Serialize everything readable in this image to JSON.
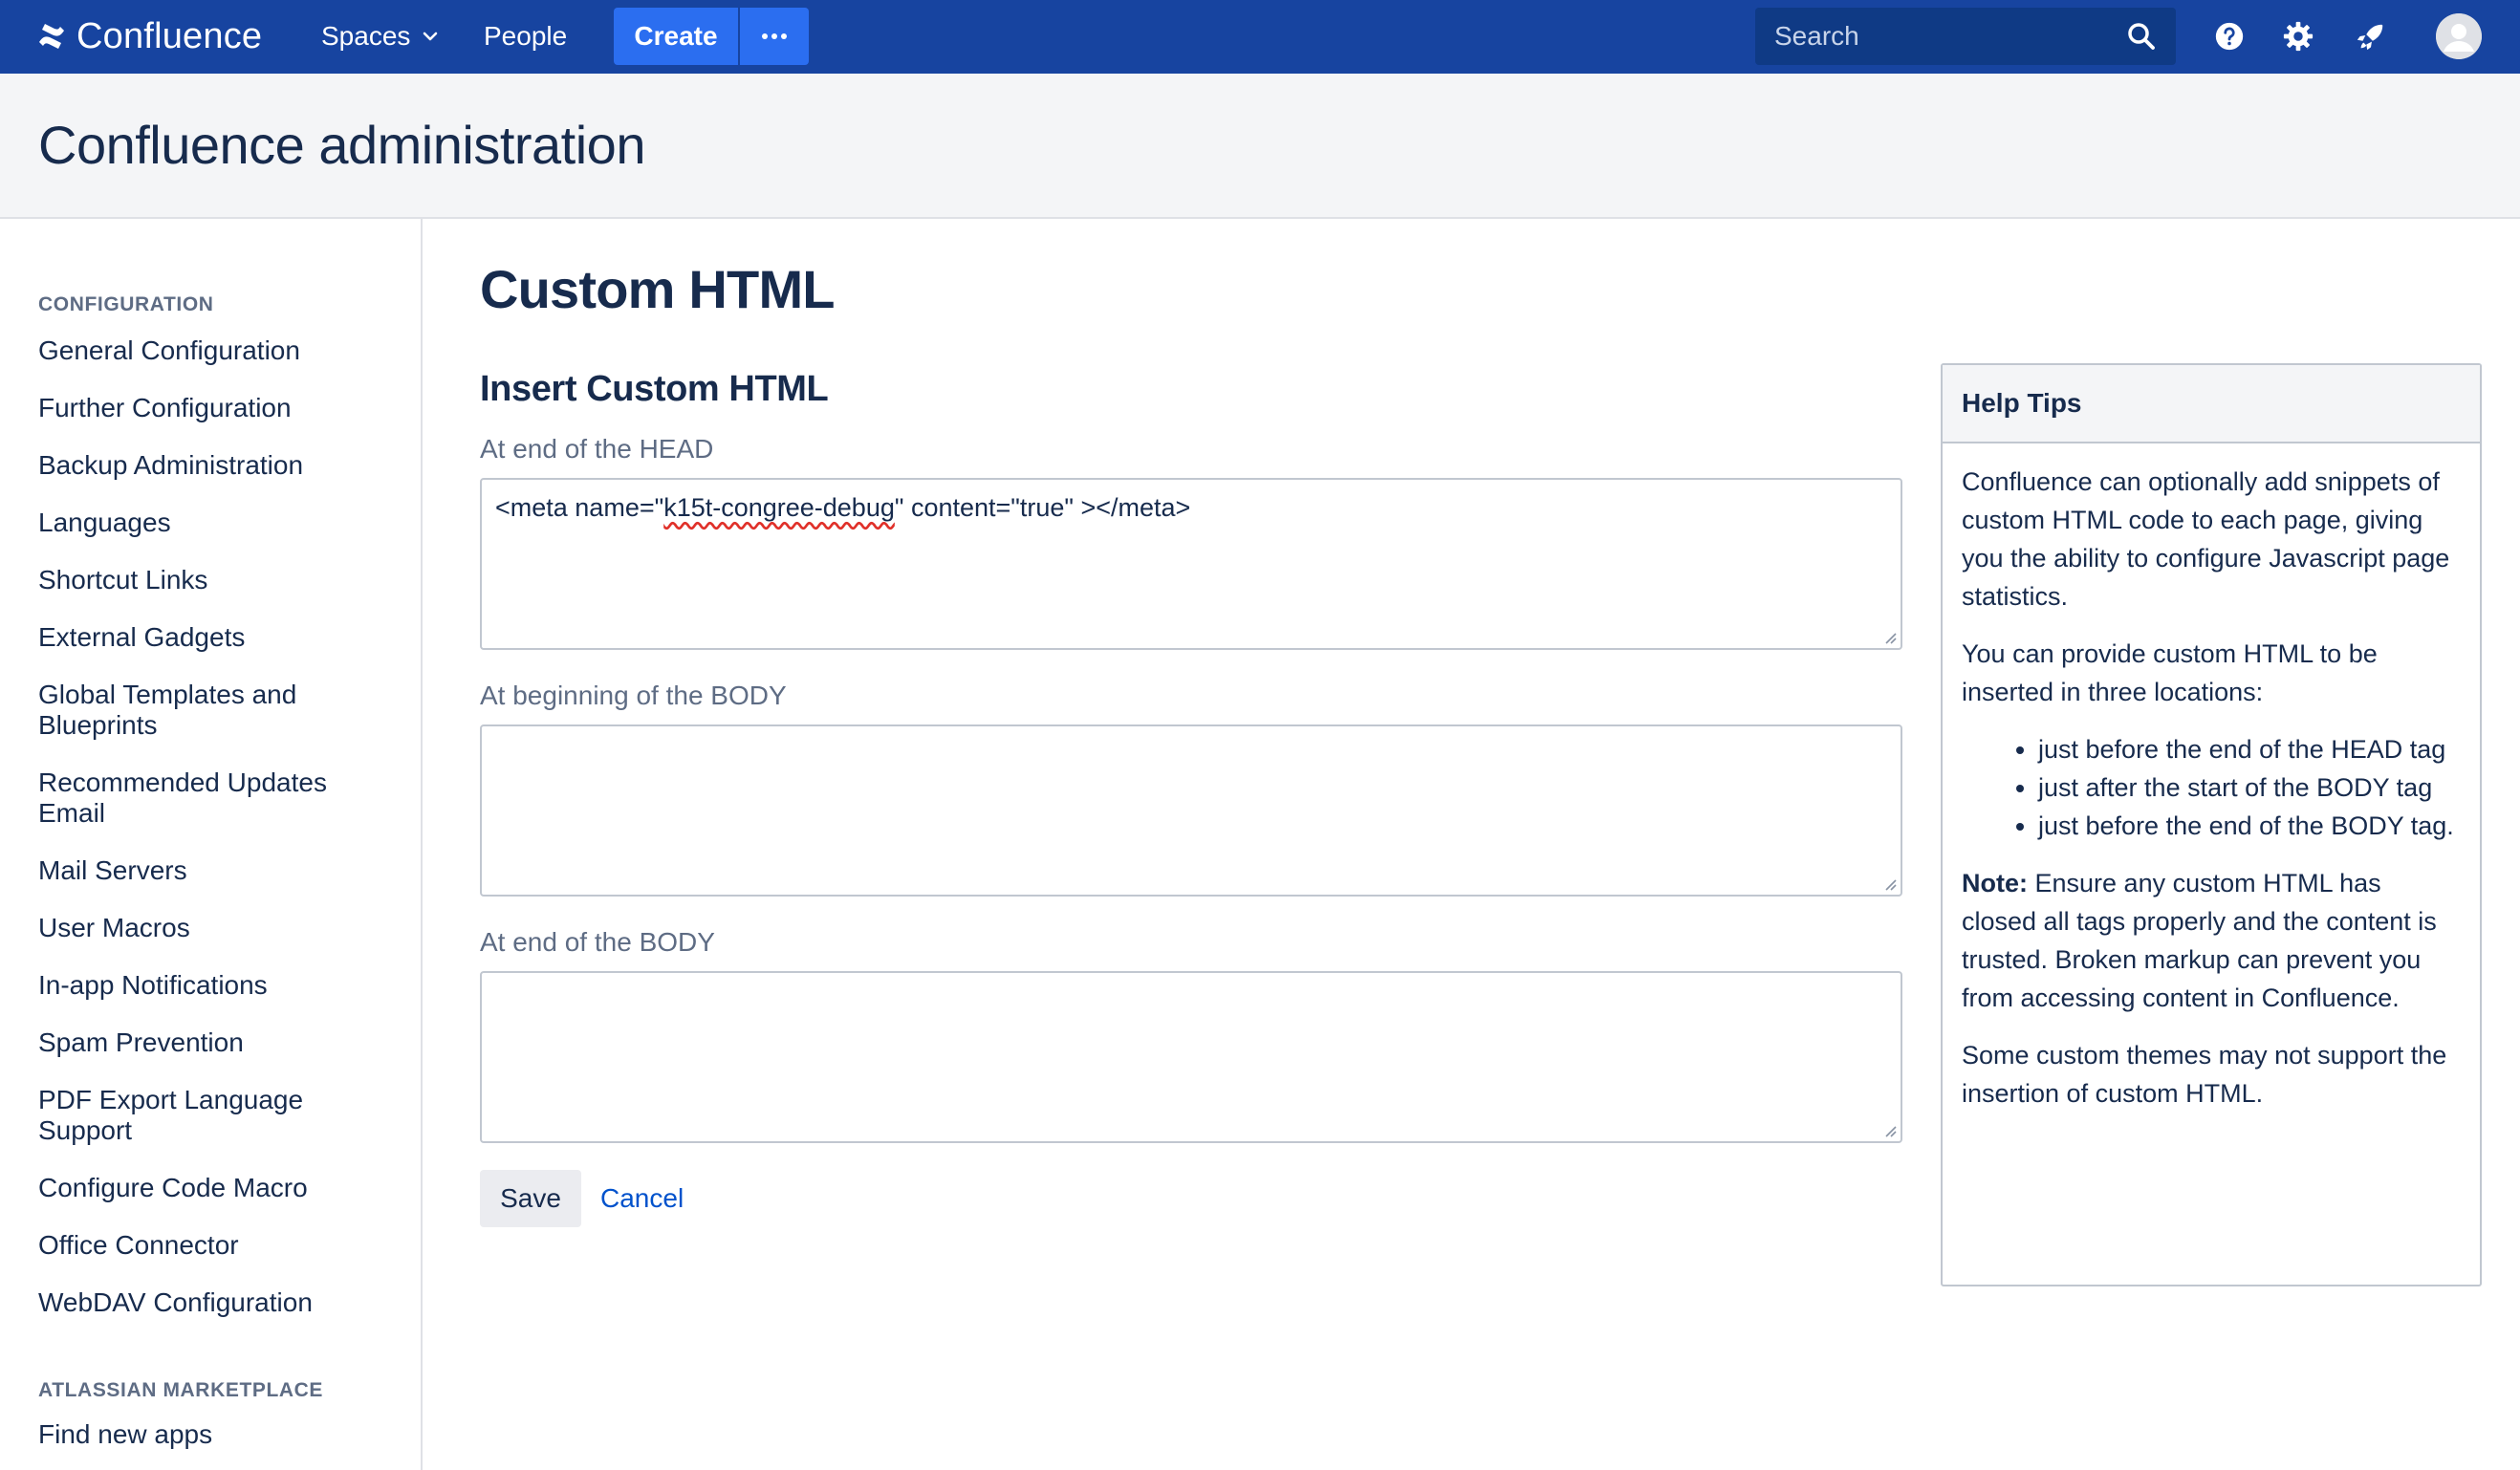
{
  "topnav": {
    "logo_text": "Confluence",
    "spaces_label": "Spaces",
    "people_label": "People",
    "create_label": "Create",
    "search_placeholder": "Search"
  },
  "admin": {
    "title": "Confluence administration"
  },
  "sidebar": {
    "configuration_heading": "CONFIGURATION",
    "items": [
      "General Configuration",
      "Further Configuration",
      "Backup Administration",
      "Languages",
      "Shortcut Links",
      "External Gadgets",
      "Global Templates and Blueprints",
      "Recommended Updates Email",
      "Mail Servers",
      "User Macros",
      "In-app Notifications",
      "Spam Prevention",
      "PDF Export Language Support",
      "Configure Code Macro",
      "Office Connector",
      "WebDAV Configuration"
    ],
    "marketplace_heading": "ATLASSIAN MARKETPLACE",
    "marketplace_items": [
      "Find new apps"
    ]
  },
  "main": {
    "page_title": "Custom HTML",
    "section_title": "Insert Custom HTML",
    "fields": [
      {
        "label": "At end of the HEAD",
        "value_prefix": "<meta name=\"",
        "value_flagged": "k15t-congree-debug",
        "value_suffix": "\" content=\"true\" ></meta>"
      },
      {
        "label": "At beginning of the BODY",
        "value": ""
      },
      {
        "label": "At end of the BODY",
        "value": ""
      }
    ],
    "save_label": "Save",
    "cancel_label": "Cancel"
  },
  "help": {
    "title": "Help Tips",
    "p1": "Confluence can optionally add snippets of custom HTML code to each page, giving you the ability to configure Javascript page statistics.",
    "p2": "You can provide custom HTML to be inserted in three locations:",
    "bullets": [
      "just before the end of the HEAD tag",
      "just after the start of the BODY tag",
      "just before the end of the BODY tag."
    ],
    "note_label": "Note:",
    "note_text": " Ensure any custom HTML has closed all tags properly and the content is trusted. Broken markup can prevent you from accessing content in Confluence.",
    "p4": "Some custom themes may not support the insertion of custom HTML."
  },
  "colors": {
    "nav_bg": "#1744a0",
    "create_bg": "#2b6ef0",
    "link": "#0052cc",
    "text": "#172b4d",
    "muted": "#5e6c84"
  },
  "icons": {
    "logo": "confluence-logo-icon",
    "spaces_caret": "chevron-down-icon",
    "more": "more-dots-icon",
    "search": "search-icon",
    "help": "help-icon",
    "settings": "gear-icon",
    "notifications": "rocket-icon",
    "avatar": "avatar-icon"
  }
}
